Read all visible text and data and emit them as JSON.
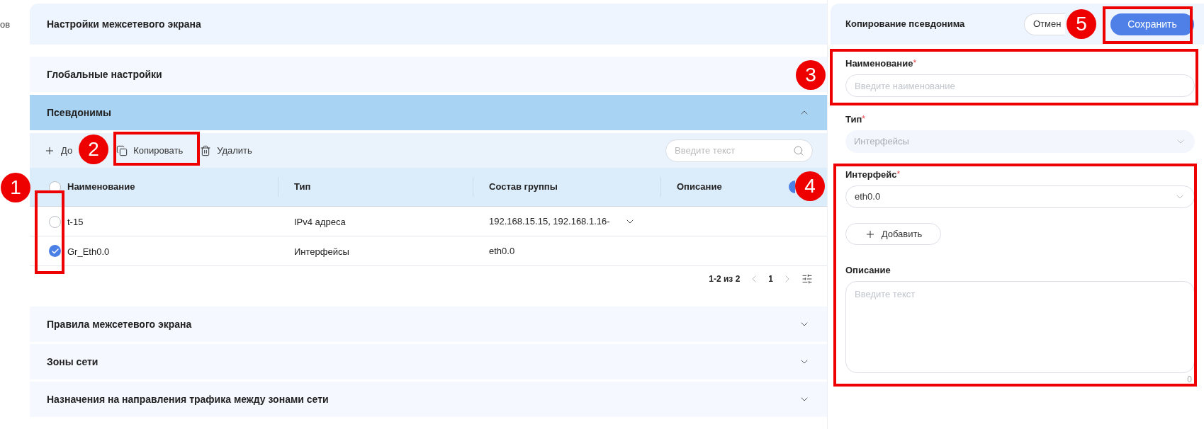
{
  "sidebar_fragment": "ов",
  "page_title": "Настройки межсетевого экрана",
  "sections_before": [
    {
      "title": "Глобальные настройки"
    }
  ],
  "aliases": {
    "title": "Псевдонимы",
    "expanded": true,
    "toolbar": [
      {
        "kind": "add",
        "label": "До"
      },
      {
        "kind": "copy",
        "label": "Копировать"
      },
      {
        "kind": "delete",
        "label": "Удалить"
      }
    ],
    "search": {
      "placeholder": "Введите текст"
    },
    "select_all": {
      "checked": false
    },
    "columns": [
      "Наименование",
      "Тип",
      "Состав группы",
      "Описание"
    ],
    "rows": [
      {
        "selected": false,
        "name": "t-15",
        "type": "IPv4 адреса",
        "members": "192.168.15.15, 192.168.1.16-",
        "members_expandable": true,
        "description": ""
      },
      {
        "selected": true,
        "name": "Gr_Eth0.0",
        "type": "Интерфейсы",
        "members": "eth0.0",
        "members_expandable": false,
        "description": ""
      }
    ],
    "pagination": {
      "range": "1-2 из 2",
      "page": "1"
    }
  },
  "sections_after": [
    {
      "title": "Правила межсетевого экрана",
      "expanded": false
    },
    {
      "title": "Зоны сети",
      "expanded": false
    },
    {
      "title": "Назначения на направления трафика между зонами сети",
      "expanded": false
    }
  ],
  "side_panel": {
    "title": "Копирование псевдонима",
    "cancel": "Отмен",
    "save": "Сохранить",
    "required_mark": "*",
    "fields": [
      {
        "kind": "input",
        "label": "Наименование",
        "required": true,
        "placeholder": "Введите наименование"
      },
      {
        "kind": "select",
        "label": "Тип",
        "required": true,
        "value": "Интерфейсы",
        "disabled": true
      },
      {
        "kind": "select",
        "label": "Интерфейс",
        "required": true,
        "value": "eth0.0",
        "disabled": false
      },
      {
        "kind": "add_button",
        "label": "Добавить"
      },
      {
        "kind": "textarea",
        "label": "Описание",
        "required": false,
        "placeholder": "Введите текст",
        "counter": "0"
      }
    ]
  },
  "annotations": [
    {
      "number": "1"
    },
    {
      "number": "2"
    },
    {
      "number": "3"
    },
    {
      "number": "4"
    },
    {
      "number": "5"
    }
  ]
}
